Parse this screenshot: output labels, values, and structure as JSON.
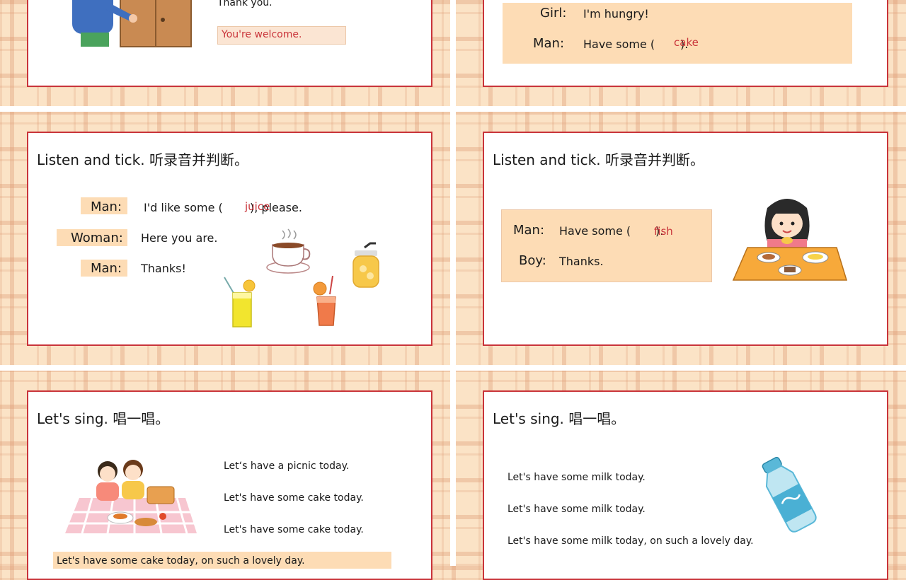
{
  "slide1": {
    "line_thanks": "Thank you.",
    "answer_welcome": "You're welcome.",
    "colors": {
      "answer_box": "#fbe5d3",
      "answer_text": "#c9343a"
    }
  },
  "slide2": {
    "rows": [
      {
        "speaker": "Girl:",
        "text": "I'm hungry!"
      },
      {
        "speaker": "Man:",
        "text": "Have some (",
        "close": ").",
        "answer": "cake"
      }
    ]
  },
  "slide3": {
    "title": "Listen and tick. 听录音并判断。",
    "rows": [
      {
        "speaker": "Man:",
        "text": "I'd like some (",
        "close": "), please.",
        "answer": "juice"
      },
      {
        "speaker": "Woman:",
        "text": "Here you are."
      },
      {
        "speaker": "Man:",
        "text": "Thanks!"
      }
    ]
  },
  "slide4": {
    "title": "Listen and tick. 听录音并判断。",
    "rows": [
      {
        "speaker": "Man:",
        "text": "Have some (",
        "close": ").",
        "answer": "fish"
      },
      {
        "speaker": "Boy:",
        "text": "Thanks."
      }
    ]
  },
  "slide5": {
    "title": "Let's sing. 唱一唱。",
    "lines": [
      "Let‘s have a picnic today.",
      "Let's have some cake today.",
      "Let's have some cake today.",
      "Let's have some cake today, on such a lovely day."
    ]
  },
  "slide6": {
    "title": "Let's sing. 唱一唱。",
    "lines": [
      "Let's have some milk today.",
      "Let's have some milk today.",
      "Let's have some milk today, on such a lovely day."
    ]
  },
  "colors": {
    "border": "#c9343a",
    "panel": "#fddcb5",
    "answer": "#c9343a",
    "background": "#fbe3c6"
  },
  "icons": [
    "boy-at-door-illustration",
    "coffee-cup-icon",
    "juice-glass-icon",
    "girl-eating-illustration",
    "picnic-kids-illustration",
    "milk-bottle-icon"
  ]
}
